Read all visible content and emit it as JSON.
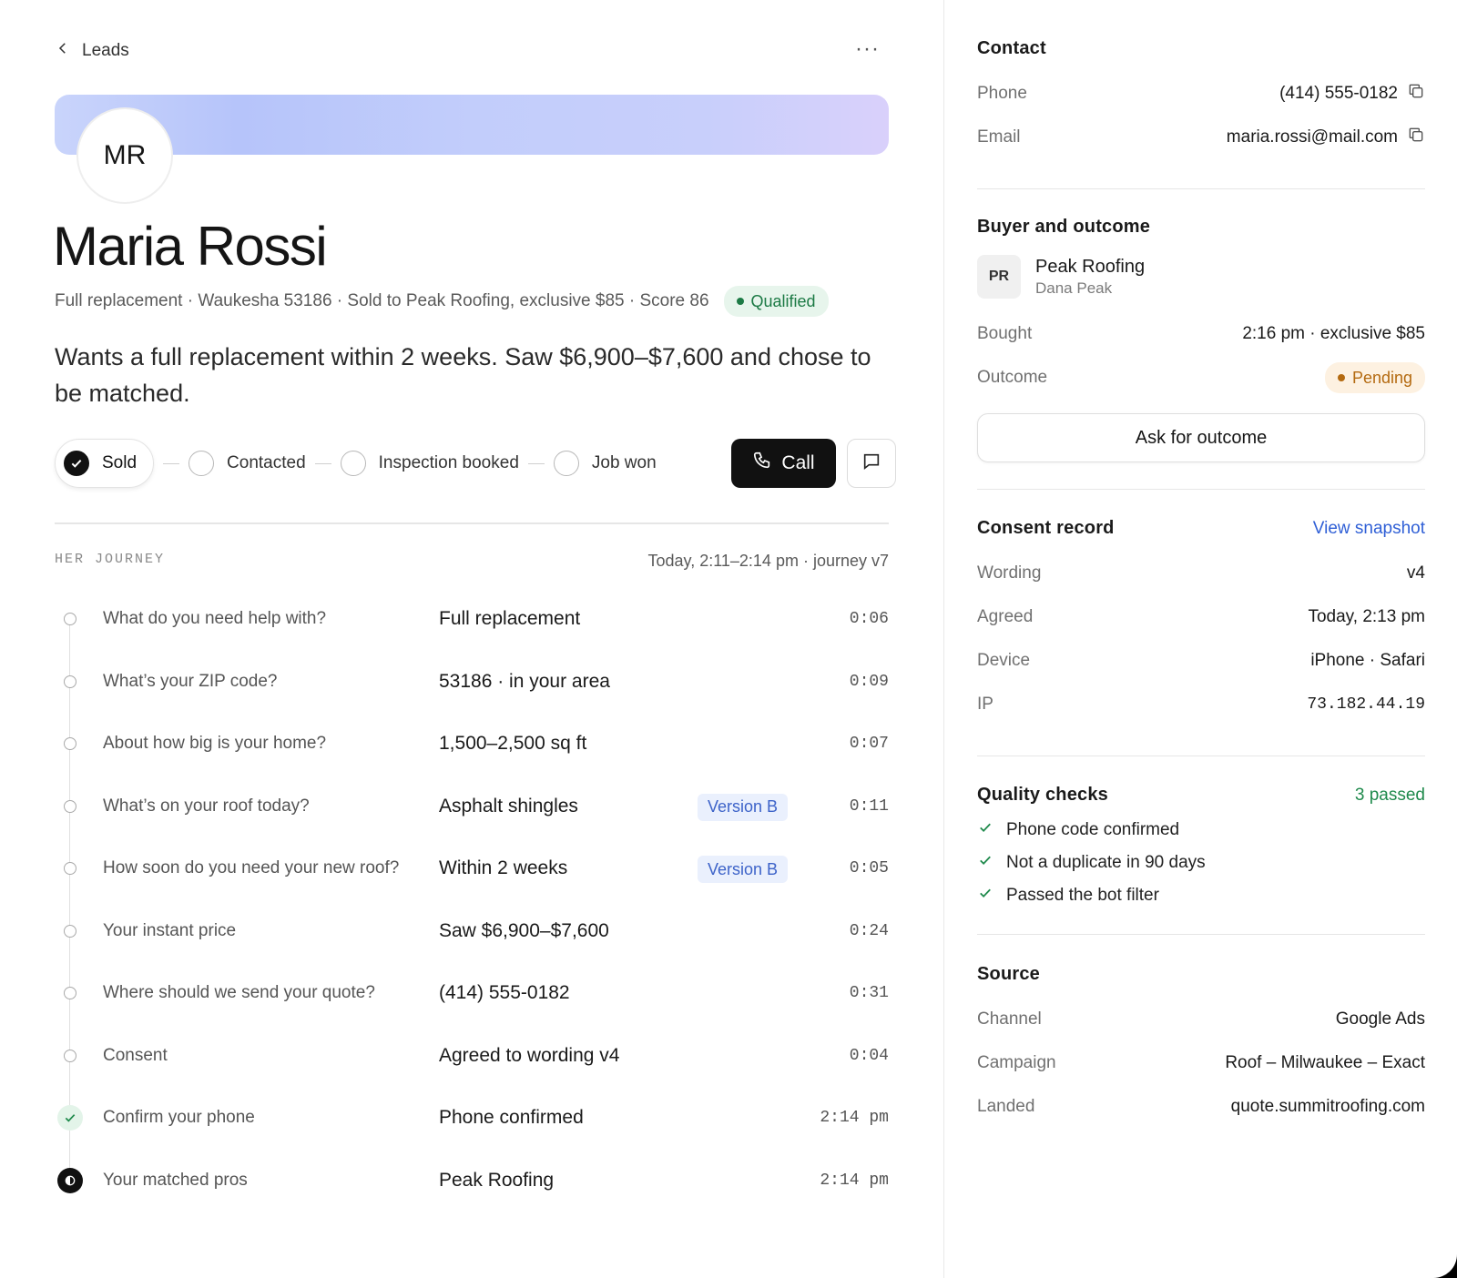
{
  "nav": {
    "back_label": "Leads",
    "more_label": "···"
  },
  "lead": {
    "initials": "MR",
    "name": "Maria Rossi",
    "meta": "Full replacement · Waukesha 53186 · Sold to Peak Roofing, exclusive $85 · Score 86",
    "status": "Qualified",
    "status_color": "#1c7a45",
    "summary": "Wants a full replacement within 2 weeks. Saw $6,900–$7,600 and chose to be matched."
  },
  "stages": [
    {
      "label": "Sold",
      "done": true
    },
    {
      "label": "Contacted",
      "done": false
    },
    {
      "label": "Inspection booked",
      "done": false
    },
    {
      "label": "Job won",
      "done": false
    }
  ],
  "actions": {
    "call_label": "Call"
  },
  "journey": {
    "title": "HER JOURNEY",
    "range": "Today, 2:11–2:14 pm · journey v7",
    "steps": [
      {
        "q": "What do you need help with?",
        "a": "Full replacement",
        "tag": "",
        "t": "0:06",
        "state": "open"
      },
      {
        "q": "What’s your ZIP code?",
        "a": "53186 · in your area",
        "tag": "",
        "t": "0:09",
        "state": "open"
      },
      {
        "q": "About how big is your home?",
        "a": "1,500–2,500 sq ft",
        "tag": "",
        "t": "0:07",
        "state": "open"
      },
      {
        "q": "What’s on your roof today?",
        "a": "Asphalt shingles",
        "tag": "Version B",
        "t": "0:11",
        "state": "open"
      },
      {
        "q": "How soon do you need your new roof?",
        "a": "Within 2 weeks",
        "tag": "Version B",
        "t": "0:05",
        "state": "open"
      },
      {
        "q": "Your instant price",
        "a": "Saw $6,900–$7,600",
        "tag": "",
        "t": "0:24",
        "state": "open"
      },
      {
        "q": "Where should we send your quote?",
        "a": "(414) 555-0182",
        "tag": "",
        "t": "0:31",
        "state": "open"
      },
      {
        "q": "Consent",
        "a": "Agreed to wording v4",
        "tag": "",
        "t": "0:04",
        "state": "open"
      },
      {
        "q": "Confirm your phone",
        "a": "Phone confirmed",
        "tag": "",
        "t": "2:14 pm",
        "state": "ok"
      },
      {
        "q": "Your matched pros",
        "a": "Peak Roofing",
        "tag": "",
        "t": "2:14 pm",
        "state": "current"
      }
    ]
  },
  "contact": {
    "title": "Contact",
    "phone_label": "Phone",
    "phone": "(414) 555-0182",
    "email_label": "Email",
    "email": "maria.rossi@mail.com"
  },
  "buyer": {
    "title": "Buyer and outcome",
    "initials": "PR",
    "company": "Peak Roofing",
    "person": "Dana Peak",
    "bought_label": "Bought",
    "bought": "2:16 pm · exclusive $85",
    "outcome_label": "Outcome",
    "outcome": "Pending",
    "outcome_color": "#b46a10",
    "ask_label": "Ask for outcome"
  },
  "consent": {
    "title": "Consent record",
    "link": "View snapshot",
    "rows": [
      {
        "k": "Wording",
        "v": "v4"
      },
      {
        "k": "Agreed",
        "v": "Today, 2:13 pm"
      },
      {
        "k": "Device",
        "v": "iPhone · Safari"
      },
      {
        "k": "IP",
        "v": "73.182.44.19"
      }
    ]
  },
  "quality": {
    "title": "Quality checks",
    "summary": "3 passed",
    "items": [
      "Phone code confirmed",
      "Not a duplicate in 90 days",
      "Passed the bot filter"
    ]
  },
  "source": {
    "title": "Source",
    "rows": [
      {
        "k": "Channel",
        "v": "Google Ads"
      },
      {
        "k": "Campaign",
        "v": "Roof – Milwaukee – Exact"
      },
      {
        "k": "Landed",
        "v": "quote.summitroofing.com"
      }
    ]
  }
}
